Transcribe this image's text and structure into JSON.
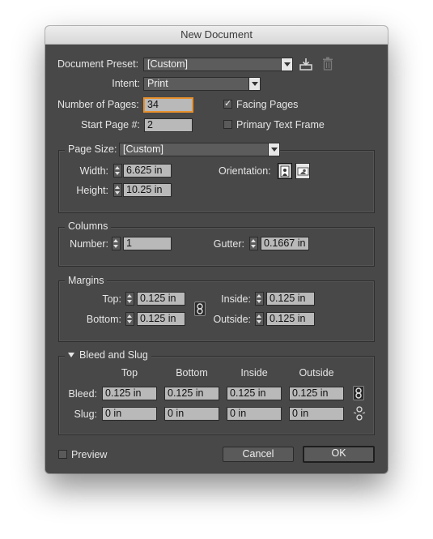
{
  "window": {
    "title": "New Document"
  },
  "preset": {
    "label": "Document Preset:",
    "value": "[Custom]"
  },
  "intent": {
    "label": "Intent:",
    "value": "Print"
  },
  "pages": {
    "number_label": "Number of Pages:",
    "number_value": "34",
    "start_label": "Start Page #:",
    "start_value": "2",
    "facing_label": "Facing Pages",
    "facing_checked": true,
    "primary_label": "Primary Text Frame",
    "primary_checked": false
  },
  "page_size": {
    "label": "Page Size:",
    "value": "[Custom]",
    "width_label": "Width:",
    "width_value": "6.625 in",
    "height_label": "Height:",
    "height_value": "10.25 in",
    "orientation_label": "Orientation:"
  },
  "columns": {
    "title": "Columns",
    "number_label": "Number:",
    "number_value": "1",
    "gutter_label": "Gutter:",
    "gutter_value": "0.1667 in"
  },
  "margins": {
    "title": "Margins",
    "top_label": "Top:",
    "top_value": "0.125 in",
    "bottom_label": "Bottom:",
    "bottom_value": "0.125 in",
    "inside_label": "Inside:",
    "inside_value": "0.125 in",
    "outside_label": "Outside:",
    "outside_value": "0.125 in"
  },
  "bleed_slug": {
    "title": "Bleed and Slug",
    "col_top": "Top",
    "col_bottom": "Bottom",
    "col_inside": "Inside",
    "col_outside": "Outside",
    "bleed_label": "Bleed:",
    "bleed": [
      "0.125 in",
      "0.125 in",
      "0.125 in",
      "0.125 in"
    ],
    "slug_label": "Slug:",
    "slug": [
      "0 in",
      "0 in",
      "0 in",
      "0 in"
    ]
  },
  "footer": {
    "preview_label": "Preview",
    "cancel_label": "Cancel",
    "ok_label": "OK"
  },
  "icons": {
    "save_preset": "save-preset-icon",
    "delete_preset": "trash-icon"
  }
}
